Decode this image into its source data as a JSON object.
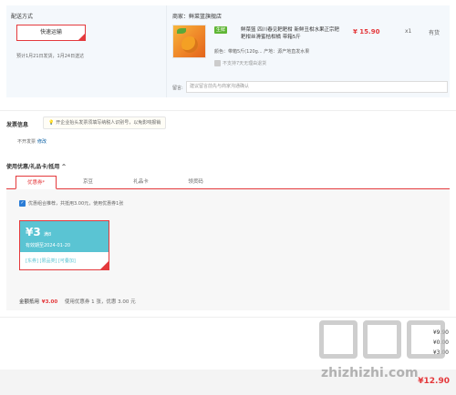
{
  "delivery": {
    "label": "配送方式",
    "option": "快速运输",
    "eta": "预计1月21日发货，1月24日送达"
  },
  "shop": {
    "name": "商家：鲜菜篮旗舰店"
  },
  "product": {
    "badge": "生鲜",
    "name": "鲜菜篮 四川春见耙耙柑 新鲜丑柑水果正宗耙耙柑丝滑蜜桔柑橘 带箱5斤",
    "spec": "颜色：带箱5斤(120g...  产地：源产地直发水果",
    "no_return": "不支持7天无理由退货",
    "price": "¥ 15.90",
    "qty": "x1",
    "stock": "有货"
  },
  "remark": {
    "label": "留言:",
    "placeholder": "建议留言前先与商家沟通确认"
  },
  "invoice": {
    "title": "发票信息",
    "tip": "开企业抬头发票须填写纳税人识别号，以免影响报销",
    "value": "不开发票",
    "modify": "修改"
  },
  "coupons": {
    "title": "使用优惠/礼品卡/抵用 ^",
    "tabs": [
      {
        "label": "优惠券",
        "sup": "*"
      },
      {
        "label": "京豆"
      },
      {
        "label": "礼品卡"
      },
      {
        "label": "领货码"
      }
    ],
    "combo_text": "优惠组合推荐，共抵用3.00元，使用优惠券1张",
    "card": {
      "amount": "¥3",
      "condition": "满8",
      "expiry": "有效期至2024-01-20",
      "tags": "[东券]  [限品类]  [可叠加]"
    },
    "summary_label": "金额抵用",
    "summary_amount": "¥3.00",
    "summary_text": "使用优惠券 1 张，优惠 3.00 元"
  },
  "totals": {
    "partial_1": "¥9.90",
    "partial_2": "¥0.00",
    "partial_3": "¥3.00",
    "total": "¥12.90"
  },
  "watermark": {
    "text": "zhizhizhi.com"
  },
  "colors": {
    "accent": "#e4393c",
    "coupon": "#5ac4d3",
    "link": "#005aa0",
    "section_bg": "#f4f8fc"
  }
}
